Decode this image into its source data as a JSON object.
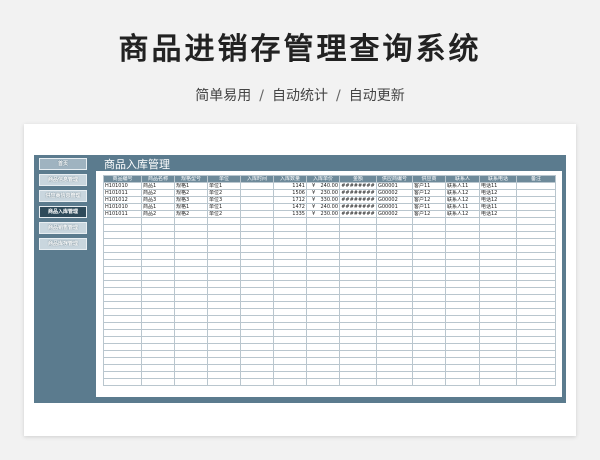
{
  "header": {
    "title": "商品进销存管理查询系统",
    "tags": [
      "简单易用",
      "自动统计",
      "自动更新"
    ],
    "separator": "/"
  },
  "sidebar": {
    "items": [
      {
        "label": "首页"
      },
      {
        "label": "商品信息管理"
      },
      {
        "label": "供应商信息管理"
      },
      {
        "label": "商品入库管理"
      },
      {
        "label": "商品销售管理"
      },
      {
        "label": "商品库存管理"
      }
    ]
  },
  "sheet": {
    "title": "商品入库管理",
    "columns": [
      "商品编号",
      "商品名称",
      "规格型号",
      "单位",
      "入库时间",
      "入库数量",
      "入库单价",
      "金额",
      "供应商编号",
      "供应商",
      "联系人",
      "联系电话",
      "备注"
    ],
    "currency": "¥",
    "rows": [
      [
        "H101010",
        "商品1",
        "规格1",
        "单位1",
        "",
        "1141",
        "240.00",
        "########",
        "G00001",
        "客户11",
        "联系人11",
        "电话11",
        ""
      ],
      [
        "H101011",
        "商品2",
        "规格2",
        "单位2",
        "",
        "1506",
        "230.00",
        "########",
        "G00002",
        "客户12",
        "联系人12",
        "电话12",
        ""
      ],
      [
        "H101012",
        "商品3",
        "规格3",
        "单位3",
        "",
        "1712",
        "330.00",
        "########",
        "G00002",
        "客户12",
        "联系人12",
        "电话12",
        ""
      ],
      [
        "H101010",
        "商品1",
        "规格1",
        "单位1",
        "",
        "1472",
        "240.00",
        "########",
        "G00001",
        "客户11",
        "联系人11",
        "电话11",
        ""
      ],
      [
        "H101011",
        "商品2",
        "规格2",
        "单位2",
        "",
        "1335",
        "230.00",
        "########",
        "G00002",
        "客户12",
        "联系人12",
        "电话12",
        ""
      ]
    ]
  }
}
